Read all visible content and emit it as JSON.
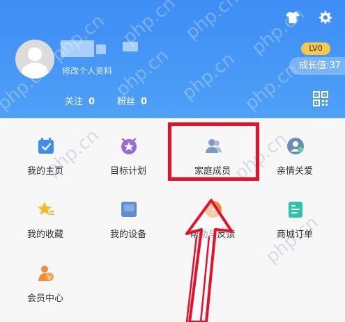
{
  "profile": {
    "edit_label": "修改个人资料",
    "level": "LV0",
    "growth": "成长值:37",
    "follow_label": "关注",
    "follow_count": "0",
    "fans_label": "粉丝",
    "fans_count": "0"
  },
  "header_icons": [
    "tshirt-icon",
    "gear-icon",
    "qr-code-icon"
  ],
  "menu": [
    {
      "label": "我的主页",
      "icon": "calendar-check-icon"
    },
    {
      "label": "目标计划",
      "icon": "target-star-icon"
    },
    {
      "label": "家庭成员",
      "icon": "family-members-icon"
    },
    {
      "label": "亲情关爱",
      "icon": "care-icon"
    },
    {
      "label": "我的收藏",
      "icon": "star-icon"
    },
    {
      "label": "我的设备",
      "icon": "device-icon"
    },
    {
      "label": "帮助与反馈",
      "icon": "help-icon"
    },
    {
      "label": "商城订单",
      "icon": "order-icon"
    },
    {
      "label": "会员中心",
      "icon": "vip-icon"
    }
  ],
  "watermark": "php.cn",
  "colors": {
    "header": "#3d8df5",
    "highlight": "#e5112a",
    "level_badge": "#f5c74a"
  }
}
